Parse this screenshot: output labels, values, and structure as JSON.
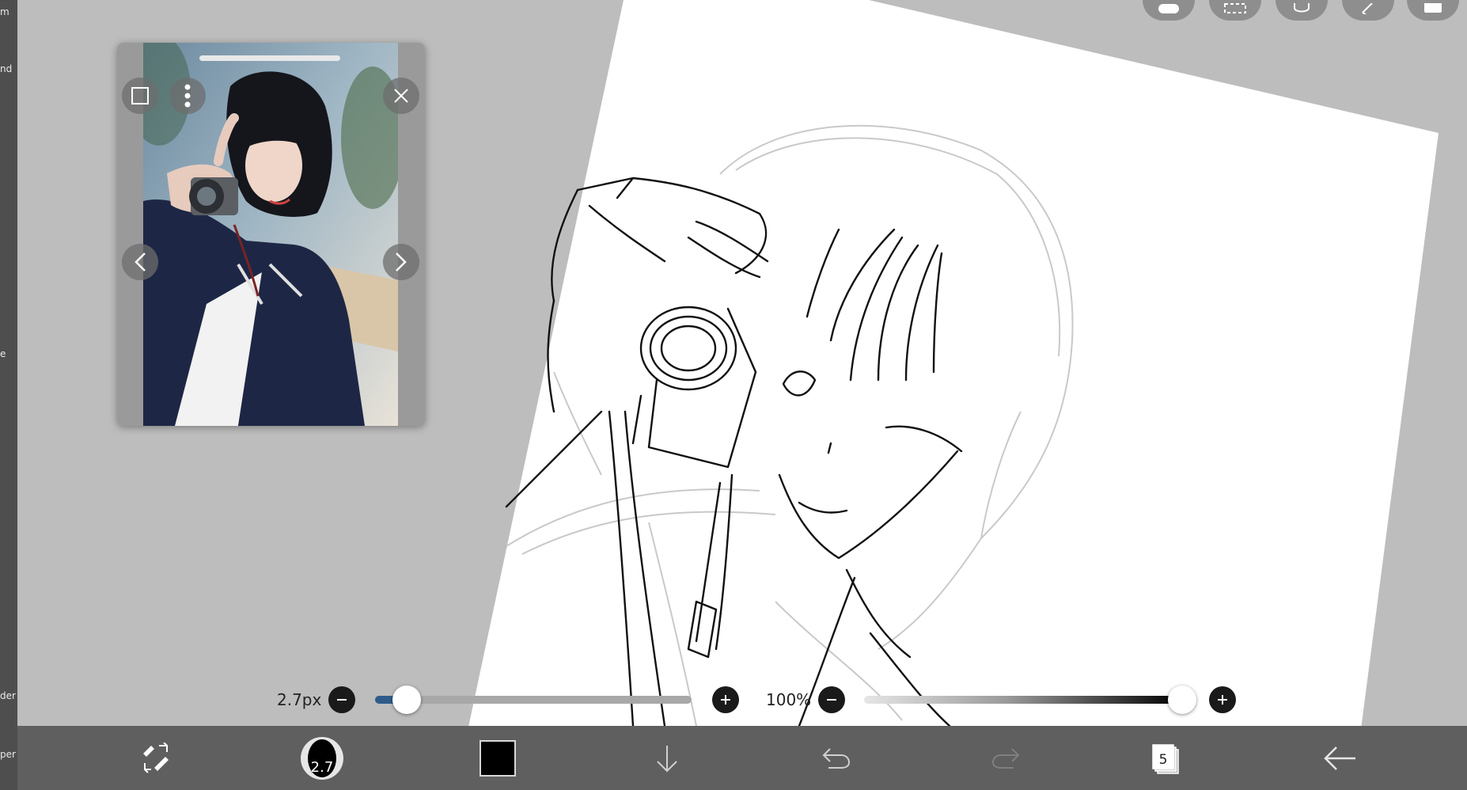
{
  "left_strip": {
    "texts": [
      "m",
      "nd",
      "e",
      "der",
      "per"
    ]
  },
  "top_toolbar": {
    "icons": [
      "cloud-toggle-icon",
      "selection-icon",
      "shape-icon",
      "ruler-icon",
      "layer-menu-icon"
    ]
  },
  "reference_window": {
    "icons": [
      "fit-frame-icon",
      "more-options-icon",
      "close-icon",
      "previous-icon",
      "next-icon"
    ]
  },
  "brush_controls": {
    "size_value": "2.7px",
    "size_fraction": 0.1,
    "opacity_value": "100%",
    "opacity_fraction": 1.0,
    "decrease_icon": "minus-icon",
    "increase_icon": "plus-icon"
  },
  "bottom_bar": {
    "brush_size_badge": "2.7",
    "current_color": "#000000",
    "layer_count": "5",
    "icons": [
      "brush-eraser-swap-icon",
      "brush-preview-icon",
      "color-swatch",
      "download-icon",
      "undo-icon",
      "redo-icon",
      "layers-icon",
      "back-icon"
    ]
  },
  "colors": {
    "workspace": "#bdbdbd",
    "bottom_bar": "#5f5f5f",
    "slider_accent": "#2f5b8a"
  }
}
